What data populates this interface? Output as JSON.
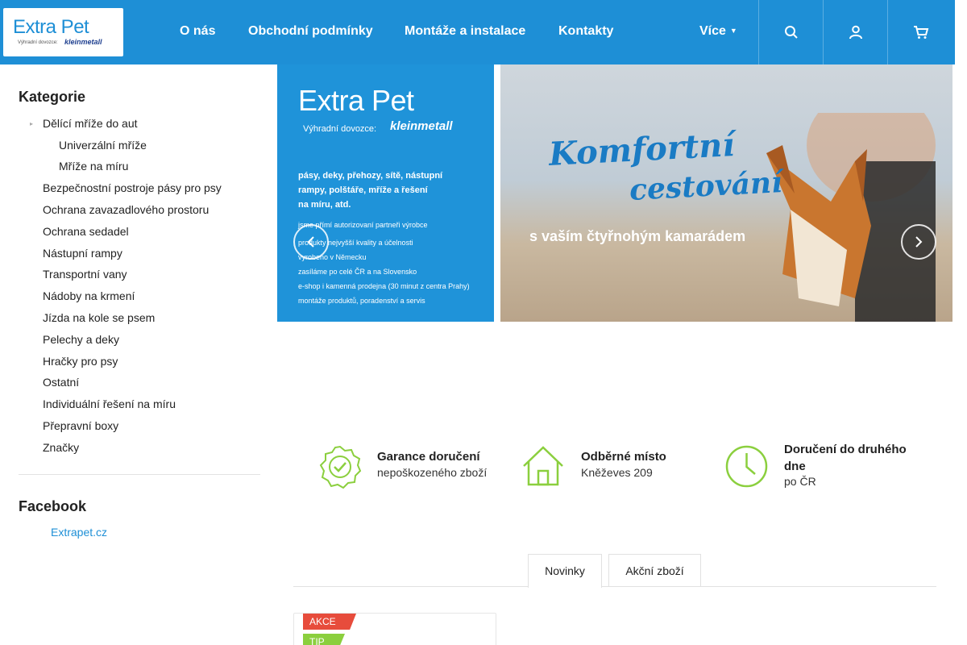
{
  "header": {
    "logo": {
      "name": "Extra Pet",
      "subtitle": "Výhradní dovozce:",
      "brand": "kleinmetall"
    },
    "nav": [
      "O nás",
      "Obchodní podmínky",
      "Montáže a instalace",
      "Kontakty"
    ],
    "more_label": "Více",
    "icons": [
      "search-icon",
      "user-icon",
      "cart-icon"
    ],
    "accent_color": "#1e8fd6"
  },
  "sidebar": {
    "categories_title": "Kategorie",
    "categories": [
      {
        "label": "Dělící mříže do aut",
        "level": 0,
        "bullet": true
      },
      {
        "label": "Univerzální mříže",
        "level": 1
      },
      {
        "label": "Mříže na míru",
        "level": 1
      },
      {
        "label": "Bezpečnostní postroje pásy pro psy",
        "level": 0
      },
      {
        "label": "Ochrana zavazadlového prostoru",
        "level": 0
      },
      {
        "label": "Ochrana sedadel",
        "level": 0
      },
      {
        "label": "Nástupní rampy",
        "level": 0
      },
      {
        "label": "Transportní vany",
        "level": 0
      },
      {
        "label": "Nádoby na krmení",
        "level": 0
      },
      {
        "label": "Jízda na kole se psem",
        "level": 0
      },
      {
        "label": "Pelechy a deky",
        "level": 0
      },
      {
        "label": "Hračky pro psy",
        "level": 0
      },
      {
        "label": "Ostatní",
        "level": 0
      },
      {
        "label": "Individuální řešení na míru",
        "level": 0
      },
      {
        "label": "Přepravní boxy",
        "level": 0
      },
      {
        "label": "Značky",
        "level": 0
      }
    ],
    "facebook_title": "Facebook",
    "facebook_link": "Extrapet.cz"
  },
  "banner": {
    "logo": "Extra Pet",
    "dealer": "Výhradní dovozce:",
    "brand": "kleinmetall",
    "bold_lines": [
      "pásy, deky, přehozy, sítě, nástupní",
      "rampy, polštáře, mříže a řešení",
      "na míru, atd."
    ],
    "small_lines": [
      "jsme přímí autorizovaní partneři výrobce",
      "produkty nejvyšší kvality a účelnosti",
      "vyrobeno v Německu",
      "zasíláme po celé ČR a na Slovensko",
      "e-shop i kamenná prodejna (30 minut z centra Prahy)",
      "montáže produktů, poradenství a servis"
    ],
    "slogan_1": "Komfortní",
    "slogan_2": "cestování",
    "slogan_3": "s vaším čtyřnohým kamarádem"
  },
  "features": [
    {
      "icon": "badge-check-icon",
      "title": "Garance doručení",
      "subtitle": "nepoškozeného zboží"
    },
    {
      "icon": "house-icon",
      "title": "Odběrné místo",
      "subtitle": "Kněževes 209"
    },
    {
      "icon": "clock-icon",
      "title": "Doručení do druhého dne",
      "subtitle": "po ČR"
    }
  ],
  "tabs": [
    "Novinky",
    "Akční zboží"
  ],
  "product": {
    "tags": [
      "AKCE",
      "TIP"
    ]
  }
}
